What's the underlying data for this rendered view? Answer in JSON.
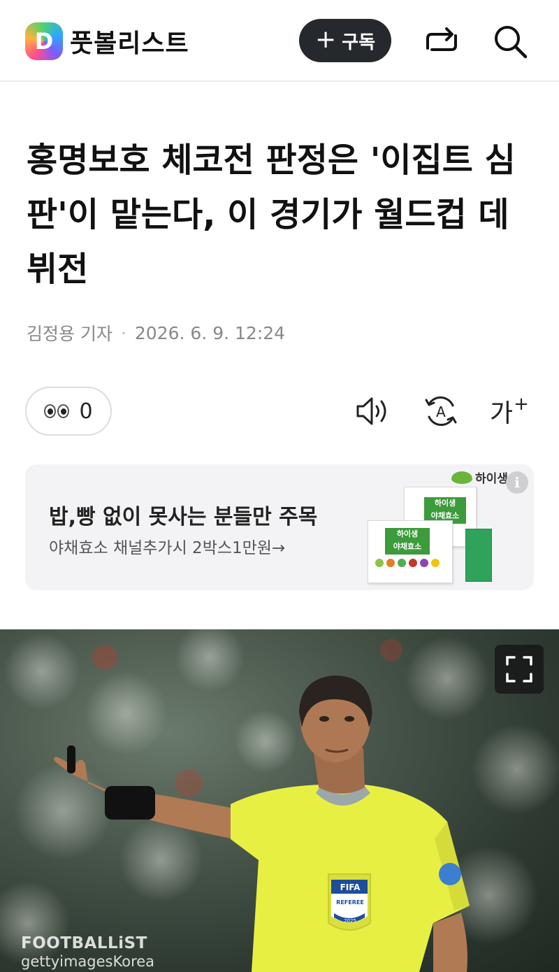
{
  "header": {
    "logo_letter": "D",
    "brand_name": "풋볼리스트",
    "subscribe_label": "구독",
    "icons": [
      "share-icon",
      "search-icon"
    ]
  },
  "article": {
    "title": "홍명보호 체코전 판정은 '이집트 심판'이 맡는다, 이 경기가 월드컵 데뷔전",
    "reporter": "김정용 기자",
    "date": "2026. 6. 9. 12:24",
    "reaction_count": "0",
    "font_size_label": "가",
    "font_size_suffix": "+"
  },
  "ad": {
    "title": "밥,빵 없이 못사는 분들만 주목",
    "subtitle": "야채효소 채널추가시 2박스1만원→",
    "brand": "하이생",
    "info_label": "i",
    "product_label_1": "하이생",
    "product_label_2": "야채효소"
  },
  "photo": {
    "credit_line1": "FOOTBALLiST",
    "credit_line2": "gettyimagesKorea",
    "badge_fifa": "FIFA",
    "badge_referee": "REFEREE",
    "badge_year": "2025"
  },
  "colors": {
    "subscribe_bg": "#25282c",
    "referee_shirt": "#e9f04a",
    "ad_bg": "#f3f3f5"
  }
}
